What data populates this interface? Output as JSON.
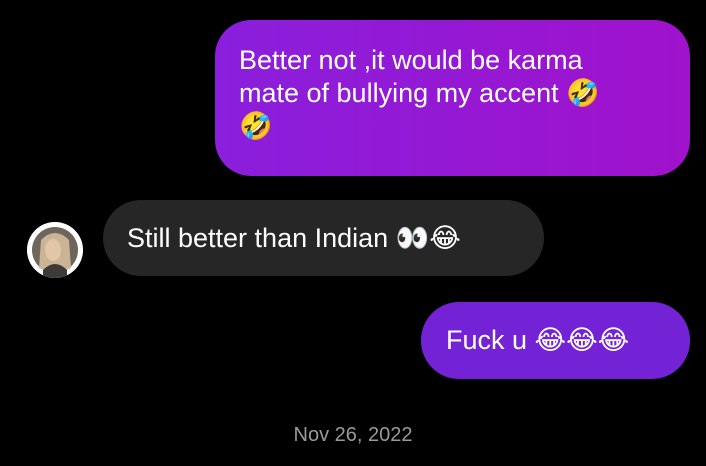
{
  "messages": [
    {
      "direction": "outgoing",
      "text": "Better not ,it would be karma\nmate of bullying my accent 🤣\n🤣"
    },
    {
      "direction": "incoming",
      "text": "Still better than Indian 👀😂"
    },
    {
      "direction": "outgoing",
      "text": "Fuck u 😂😂😂"
    }
  ],
  "timestamp": "Nov 26, 2022",
  "avatar_icon": "contact-profile-photo",
  "colors": {
    "background": "#000000",
    "outgoing_bubble": "#8a1fdc",
    "outgoing_bubble_alt": "#7422d6",
    "incoming_bubble": "#262626",
    "timestamp": "#9a9a9a",
    "text": "#ffffff"
  }
}
